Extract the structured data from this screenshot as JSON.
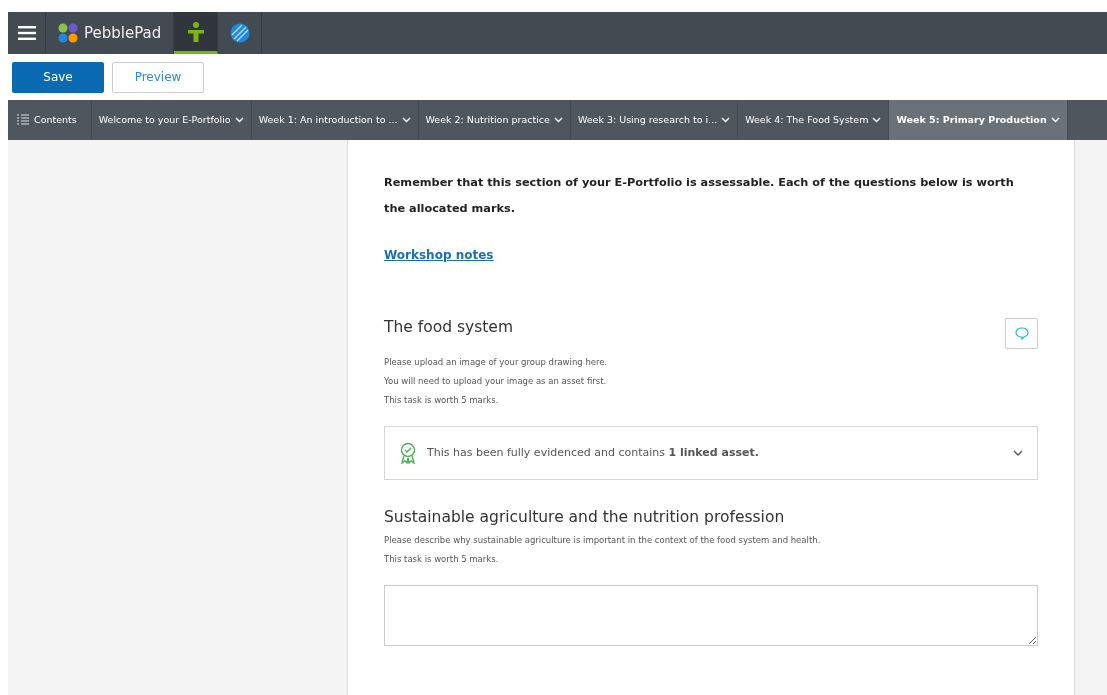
{
  "app": {
    "name": "PebblePad"
  },
  "toolbar": {
    "buttons": [
      {
        "label": "Save",
        "kind": "primary"
      },
      {
        "label": "Preview",
        "kind": "secondary"
      }
    ]
  },
  "tabs": [
    {
      "label": "Contents",
      "kind": "contents",
      "selected": false
    },
    {
      "label": "Welcome to your E-Portfolio",
      "kind": "page",
      "selected": false
    },
    {
      "label": "Week 1: An introduction to ...",
      "kind": "page",
      "selected": false
    },
    {
      "label": "Week 2: Nutrition practice",
      "kind": "page",
      "selected": false
    },
    {
      "label": "Week 3: Using research to i...",
      "kind": "page",
      "selected": false
    },
    {
      "label": "Week 4: The Food System",
      "kind": "page",
      "selected": false
    },
    {
      "label": "Week 5: Primary Production",
      "kind": "page",
      "selected": true
    }
  ],
  "intro": "Remember that this section of your E-Portfolio is assessable. Each of the questions below is worth the allocated marks.",
  "link": "Workshop notes",
  "tasks": [
    {
      "kind": "evidence",
      "title": "The food system",
      "lines": [
        "Please upload an image of your group drawing here.",
        "You will need to upload your image as an asset first.",
        "This task is worth 5 marks."
      ],
      "evidence": "This has been fully evidenced and contains **1 linked asset.**"
    },
    {
      "kind": "text",
      "title": "Sustainable agriculture and the nutrition profession",
      "lines": [
        "Please describe why sustainable agriculture is important in the context of the food system and health.",
        "This task is worth 5 marks."
      ]
    }
  ]
}
